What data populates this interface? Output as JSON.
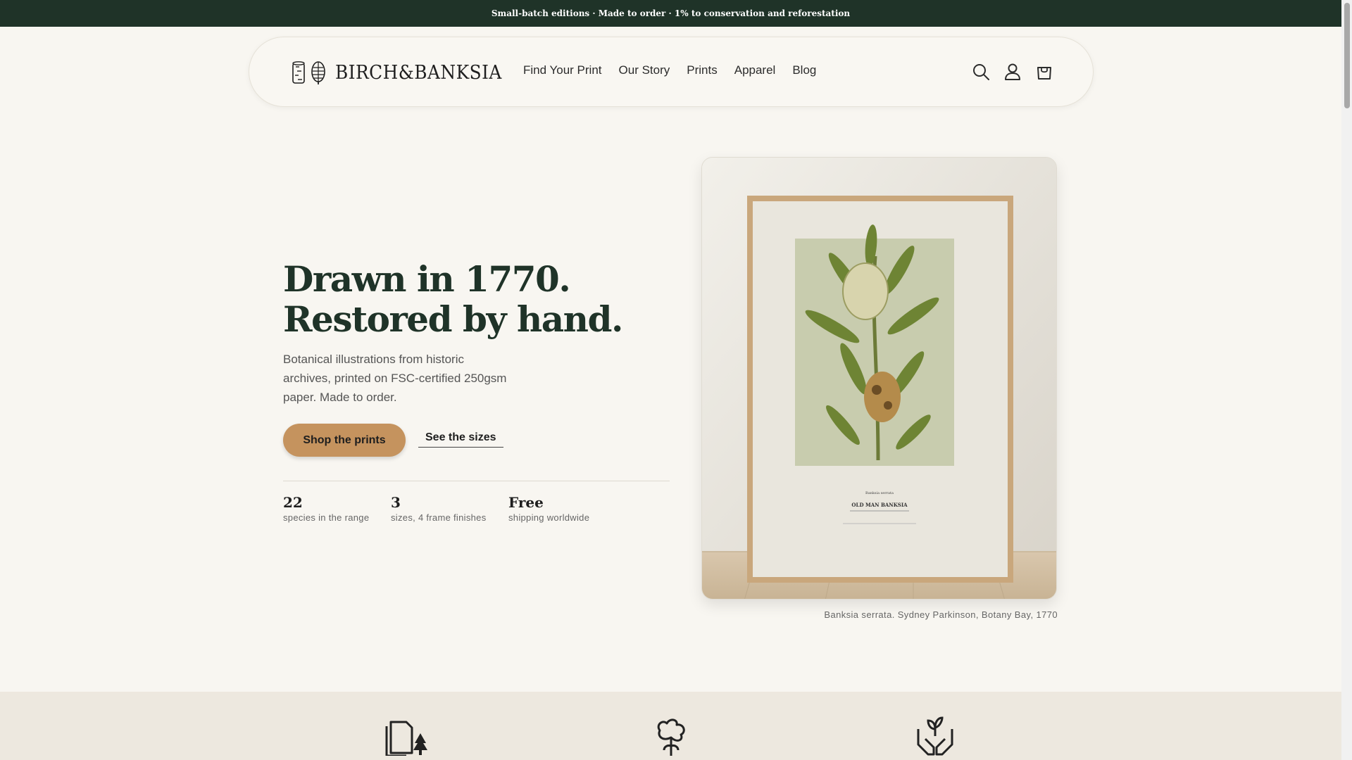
{
  "announcement": "Small-batch editions · Made to order · 1% to conservation and reforestation",
  "header": {
    "logo_text": "BIRCH&BANKSIA",
    "nav": [
      "Find Your Print",
      "Our Story",
      "Prints",
      "Apparel",
      "Blog"
    ],
    "icons": [
      "search-icon",
      "account-icon",
      "cart-icon"
    ]
  },
  "hero": {
    "title_line1": "Drawn in 1770.",
    "title_line2": "Restored by hand.",
    "description": "Botanical illustrations from historic archives, printed on FSC-certified 250gsm paper. Made to order.",
    "primary_cta": "Shop the prints",
    "secondary_cta": "See the sizes",
    "stats": [
      {
        "value": "22",
        "label": "species in the range"
      },
      {
        "value": "3",
        "label": "sizes, 4 frame finishes"
      },
      {
        "value": "Free",
        "label": "shipping worldwide"
      }
    ],
    "print": {
      "species": "Banksia serrata",
      "name": "OLD MAN BANKSIA"
    },
    "caption": "Banksia serrata. Sydney Parkinson, Botany Bay, 1770"
  },
  "features": {
    "icons": [
      "paper-tree-icon",
      "cotton-plant-icon",
      "hands-sprout-icon"
    ]
  },
  "colors": {
    "announcement_bg": "#1f3328",
    "heading": "#1f3328",
    "accent": "#c5935e",
    "page_bg": "#f8f6f1",
    "band_bg": "#ede8df"
  }
}
